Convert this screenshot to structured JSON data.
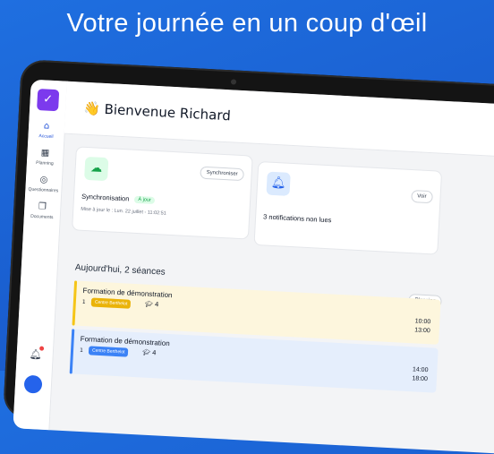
{
  "headline": "Votre journée en un coup d'œil",
  "sidebar": {
    "logo_icon": "calendar-check-icon",
    "items": [
      {
        "label": "Accueil",
        "icon": "home-icon"
      },
      {
        "label": "Planning",
        "icon": "calendar-icon"
      },
      {
        "label": "Questionnaires",
        "icon": "questionnaire-icon"
      },
      {
        "label": "Documents",
        "icon": "documents-icon"
      }
    ]
  },
  "header": {
    "welcome": "Bienvenue Richard",
    "wave_icon": "wave-hand-icon"
  },
  "sync_card": {
    "icon": "cloud-check-icon",
    "button": "Synchroniser",
    "title": "Synchronisation",
    "badge": "À jour",
    "updated": "Mise à jour le : Lun. 22 juillet - 11:02:51"
  },
  "notif_card": {
    "icon": "bell-icon",
    "button": "Voir",
    "text": "3 notifications non lues"
  },
  "today": {
    "title": "Aujourd'hui, 2 séances",
    "planning_button": "Planning",
    "sessions": [
      {
        "title": "Formation de démonstration",
        "number": "1",
        "tag": "Centre Berthelot",
        "count": "4",
        "start": "10:00",
        "end": "13:00",
        "color": "#f5c518",
        "bg": "#fdf6dd",
        "tag_color": "#eab308"
      },
      {
        "title": "Formation de démonstration",
        "number": "1",
        "tag": "Centre Berthelot",
        "count": "4",
        "start": "14:00",
        "end": "18:00",
        "color": "#3b82f6",
        "bg": "#e5eefc",
        "tag_color": "#3b82f6"
      }
    ]
  },
  "colors": {
    "background": "#1a5fd0",
    "accent": "#2563eb",
    "brand": "#7c3aed"
  }
}
